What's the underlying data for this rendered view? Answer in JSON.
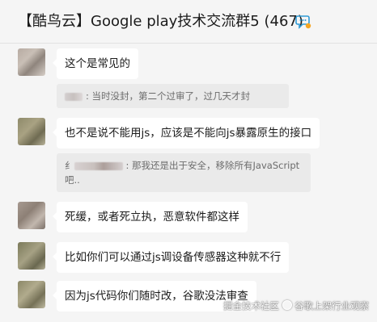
{
  "header": {
    "title": "【酷鸟云】Google play技术交流群5 (467)",
    "group_icon": "group-chat-icon"
  },
  "messages": [
    {
      "text": "这个是常见的",
      "quote": {
        "text": ": 当时没封，第二个过审了，过几天才封"
      }
    },
    {
      "text": "也不是说不能用js，应该是不能向js暴露原生的接口",
      "quote": {
        "prefix": "纟",
        "text": ": 那我还是出于安全，移除所有JavaScript",
        "text2": "吧.."
      }
    },
    {
      "text": "死缓，或者死立执，恶意软件都这样"
    },
    {
      "text": "比如你们可以通过js调设备传感器这种就不行"
    },
    {
      "text": "因为js代码你们随时改，谷歌没法审查"
    }
  ],
  "watermark": {
    "left": "掘金技术社区",
    "right": "谷歌上架行业观察"
  },
  "colors": {
    "background": "#f5f5f5",
    "bubble": "#ffffff",
    "quote": "#eaeaea",
    "accent": "#2f9bd6"
  }
}
